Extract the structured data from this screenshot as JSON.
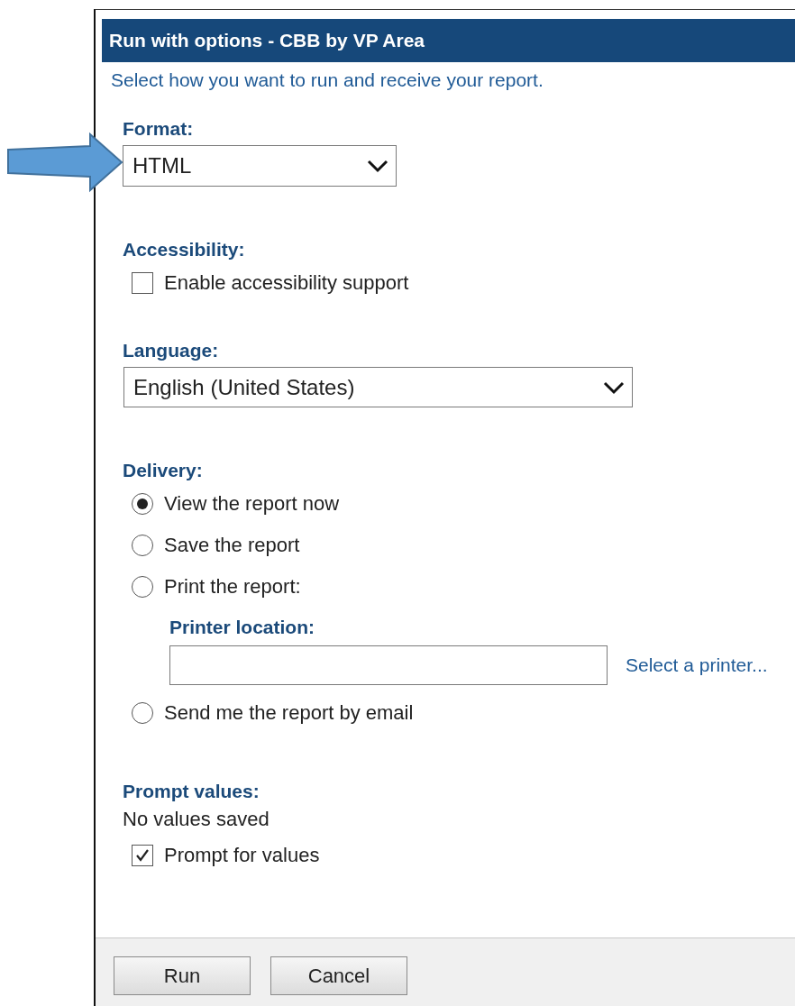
{
  "dialog": {
    "title": "Run with options - CBB by VP Area",
    "subtitle": "Select how you want to run and receive your report.",
    "format": {
      "label": "Format:",
      "value": "HTML"
    },
    "accessibility": {
      "label": "Accessibility:",
      "option": {
        "label": "Enable accessibility support",
        "checked": false
      }
    },
    "language": {
      "label": "Language:",
      "value": "English (United States)"
    },
    "delivery": {
      "label": "Delivery:",
      "options": [
        {
          "label": "View the report now",
          "selected": true
        },
        {
          "label": "Save the report",
          "selected": false
        },
        {
          "label": "Print the report:",
          "selected": false,
          "printer": {
            "label": "Printer location:",
            "link": "Select a printer..."
          }
        },
        {
          "label": "Send me the report by email",
          "selected": false
        }
      ]
    },
    "prompt_values": {
      "label": "Prompt values:",
      "status": "No values saved",
      "option": {
        "label": "Prompt for values",
        "checked": true
      }
    },
    "buttons": [
      "Run",
      "Cancel"
    ]
  }
}
